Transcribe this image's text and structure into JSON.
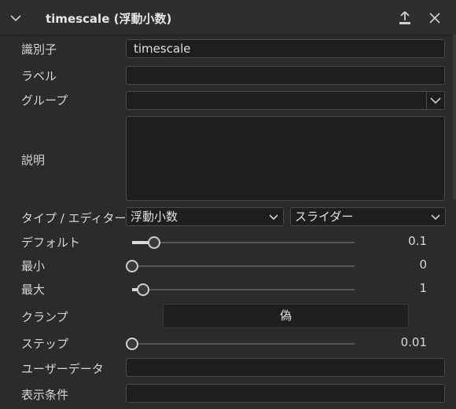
{
  "header": {
    "title": "timescale (浮動小数)",
    "icons": [
      "chevron-down-icon",
      "upload-icon",
      "close-icon"
    ]
  },
  "fields": {
    "identifier": {
      "label": "識別子",
      "value": "timescale"
    },
    "label": {
      "label": "ラベル",
      "value": ""
    },
    "group": {
      "label": "グループ",
      "value": ""
    },
    "description": {
      "label": "説明",
      "value": ""
    }
  },
  "type_editor": {
    "label": "タイプ / エディター",
    "type_value": "浮動小数",
    "editor_value": "スライダー"
  },
  "default": {
    "label": "デフォルト",
    "value": "0.1",
    "level": 0.1
  },
  "min": {
    "label": "最小",
    "value": "0",
    "level": 0.0
  },
  "max": {
    "label": "最大",
    "value": "1",
    "level": 0.05
  },
  "clamp": {
    "label": "クランプ",
    "value": "偽"
  },
  "step": {
    "label": "ステップ",
    "value": "0.01",
    "level": 0.0
  },
  "user_data": {
    "label": "ユーザーデータ",
    "value": ""
  },
  "display_condition": {
    "label": "表示条件",
    "value": ""
  }
}
